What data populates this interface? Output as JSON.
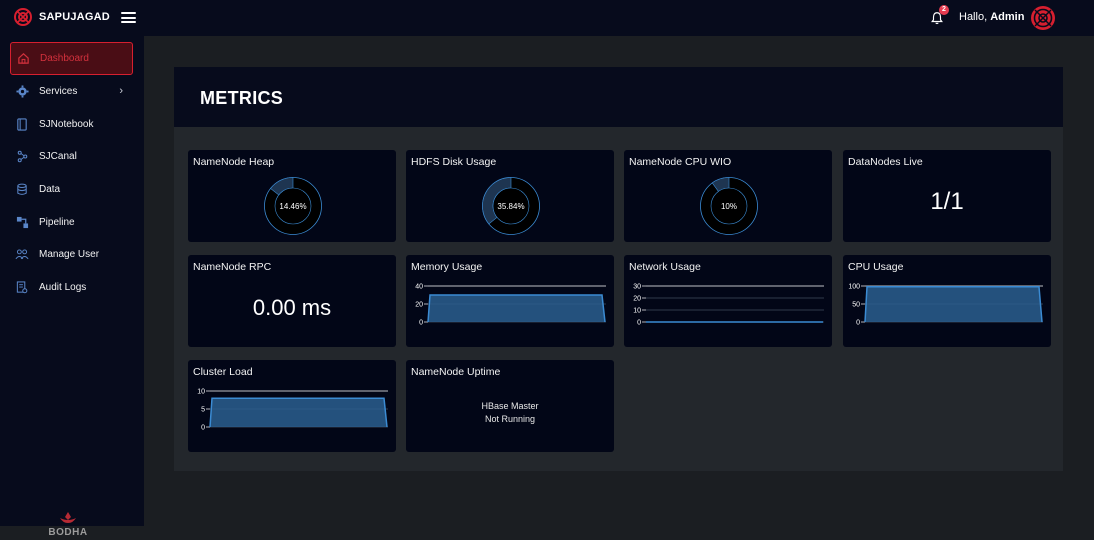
{
  "header": {
    "brand": "SAPUJAGAD",
    "greeting_prefix": "Hallo,",
    "user": "Admin",
    "notification_count": "2",
    "colors": {
      "accent": "#d71f2f",
      "panel": "#070b1c",
      "bg": "#1b1e22",
      "chart": "#3b8bd3"
    }
  },
  "sidebar": {
    "items": [
      {
        "label": "Dashboard",
        "icon": "home-icon",
        "active": true
      },
      {
        "label": "Services",
        "icon": "gear-icon",
        "has_submenu": true
      },
      {
        "label": "SJNotebook",
        "icon": "notebook-icon"
      },
      {
        "label": "SJCanal",
        "icon": "canal-icon"
      },
      {
        "label": "Data",
        "icon": "database-icon"
      },
      {
        "label": "Pipeline",
        "icon": "pipeline-icon"
      },
      {
        "label": "Manage User",
        "icon": "users-icon"
      },
      {
        "label": "Audit Logs",
        "icon": "audit-icon"
      }
    ],
    "footer_logo": "BODHA"
  },
  "main": {
    "title": "METRICS",
    "tiles": {
      "namenode_heap": {
        "title": "NameNode Heap",
        "value_label": "14.46%",
        "fraction": 0.1446
      },
      "hdfs_disk": {
        "title": "HDFS Disk Usage",
        "value_label": "35.84%",
        "fraction": 0.3584
      },
      "namenode_cpu": {
        "title": "NameNode CPU WIO",
        "value_label": "10%",
        "fraction": 0.1
      },
      "datanodes": {
        "title": "DataNodes Live",
        "value": "1/1"
      },
      "namenode_rpc": {
        "title": "NameNode RPC",
        "value": "0.00 ms"
      },
      "memory": {
        "title": "Memory Usage"
      },
      "network": {
        "title": "Network Usage"
      },
      "cpu": {
        "title": "CPU Usage"
      },
      "cluster_load": {
        "title": "Cluster Load"
      },
      "uptime": {
        "title": "NameNode Uptime",
        "line1": "HBase Master",
        "line2": "Not Running"
      }
    }
  },
  "chart_data": [
    {
      "type": "area",
      "title": "Memory Usage",
      "ylim": [
        0,
        40
      ],
      "yticks": [
        "40",
        "20",
        "0"
      ],
      "level": 30
    },
    {
      "type": "line",
      "title": "Network Usage",
      "ylim": [
        0,
        30
      ],
      "yticks": [
        "30",
        "20",
        "10",
        "0"
      ],
      "level": 0
    },
    {
      "type": "area",
      "title": "CPU Usage",
      "ylim": [
        0,
        100
      ],
      "yticks": [
        "100",
        "50",
        "0"
      ],
      "level": 98
    },
    {
      "type": "area",
      "title": "Cluster Load",
      "ylim": [
        0,
        10
      ],
      "yticks": [
        "10",
        "5",
        "0"
      ],
      "level": 8
    }
  ]
}
